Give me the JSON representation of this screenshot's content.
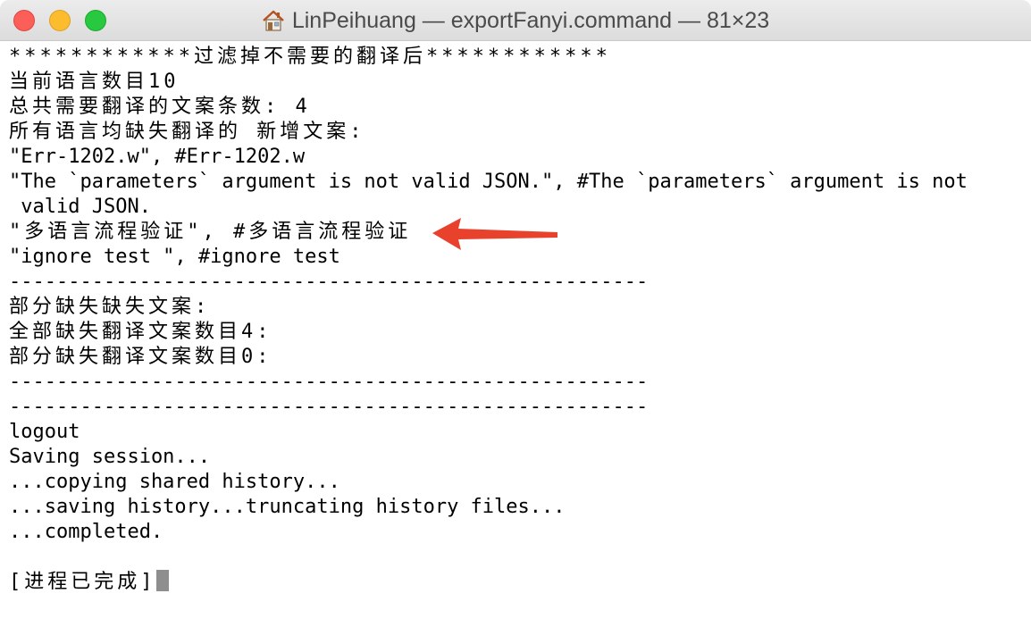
{
  "window": {
    "title": "LinPeihuang — exportFanyi.command — 81×23",
    "home_icon": "home-icon",
    "close_color": "#fc5f57",
    "minimize_color": "#fdbc2e",
    "maximize_color": "#28c840"
  },
  "terminal": {
    "lines": [
      "************过滤掉不需要的翻译后************",
      "当前语言数目10",
      "总共需要翻译的文案条数: 4",
      "所有语言均缺失翻译的 新增文案:",
      "\"Err-1202.w\", #Err-1202.w",
      "\"The `parameters` argument is not valid JSON.\", #The `parameters` argument is not",
      " valid JSON.",
      "\"多语言流程验证\", #多语言流程验证",
      "\"ignore test \", #ignore test",
      "------------------------------------------------------",
      "部分缺失缺失文案:",
      "全部缺失翻译文案数目4:",
      "部分缺失翻译文案数目0:",
      "------------------------------------------------------",
      "------------------------------------------------------",
      "logout",
      "Saving session...",
      "...copying shared history...",
      "...saving history...truncating history files...",
      "...completed.",
      "",
      "[进程已完成]"
    ]
  },
  "annotation": {
    "arrow_color": "#e8412c"
  }
}
